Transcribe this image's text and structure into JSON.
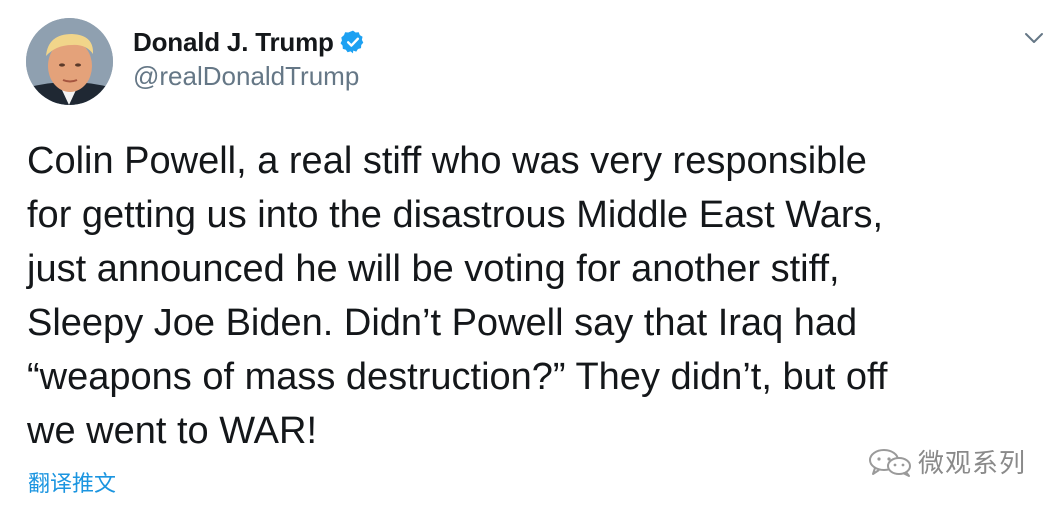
{
  "tweet": {
    "author": {
      "display_name": "Donald J. Trump",
      "handle": "@realDonaldTrump",
      "verified": true,
      "avatar": "profile-photo"
    },
    "text": "Colin Powell, a real stiff who was very responsible\nfor getting us into the disastrous Middle East Wars,\njust announced he will be voting for another stiff,\nSleepy Joe Biden. Didn’t Powell say that Iraq had\n“weapons of mass destruction?” They didn’t, but off\nwe went to WAR!",
    "translate_label": "翻译推文",
    "menu_icon": "chevron-down-icon"
  },
  "watermark": {
    "text": "微观系列",
    "icon": "wechat-icon"
  },
  "colors": {
    "verified_badge": "#1da1f2",
    "link": "#1b95e0",
    "handle": "#657786",
    "text": "#14171a"
  }
}
